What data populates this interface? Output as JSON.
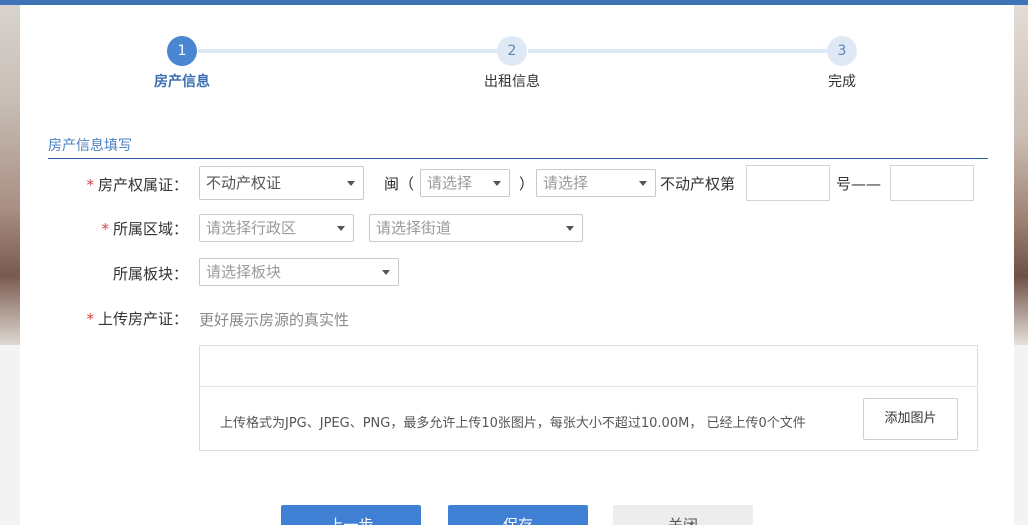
{
  "steps": [
    {
      "number": "1",
      "label": "房产信息",
      "state": "active"
    },
    {
      "number": "2",
      "label": "出租信息",
      "state": "todo"
    },
    {
      "number": "3",
      "label": "完成",
      "state": "todo"
    }
  ],
  "section": {
    "title": "房产信息填写"
  },
  "form": {
    "cert": {
      "required_mark": "*",
      "label": "房产权属证：",
      "type_value": "不动产权证",
      "region_prefix": "闽（",
      "region_placeholder": "请选择",
      "region_suffix": "）",
      "year_placeholder": "请选择",
      "number_prefix": "不动产权第",
      "number_suffix": "号——"
    },
    "area": {
      "required_mark": "*",
      "label": "所属区域：",
      "district_placeholder": "请选择行政区",
      "street_placeholder": "请选择街道"
    },
    "block": {
      "label": "所属板块：",
      "block_placeholder": "请选择板块"
    },
    "upload": {
      "required_mark": "*",
      "label": "上传房产证：",
      "hint": "更好展示房源的真实性",
      "info": "上传格式为JPG、JPEG、PNG，最多允许上传10张图片，每张大小不超过10.00M， 已经上传0个文件",
      "add_button": "添加图片"
    }
  },
  "footer": {
    "prev": "上一步",
    "next": "保存",
    "cancel": "关闭"
  },
  "colors": {
    "accent": "#3f73b8",
    "step_active": "#4a86d1",
    "step_todo": "#dfe9f5",
    "required": "#d24444"
  }
}
